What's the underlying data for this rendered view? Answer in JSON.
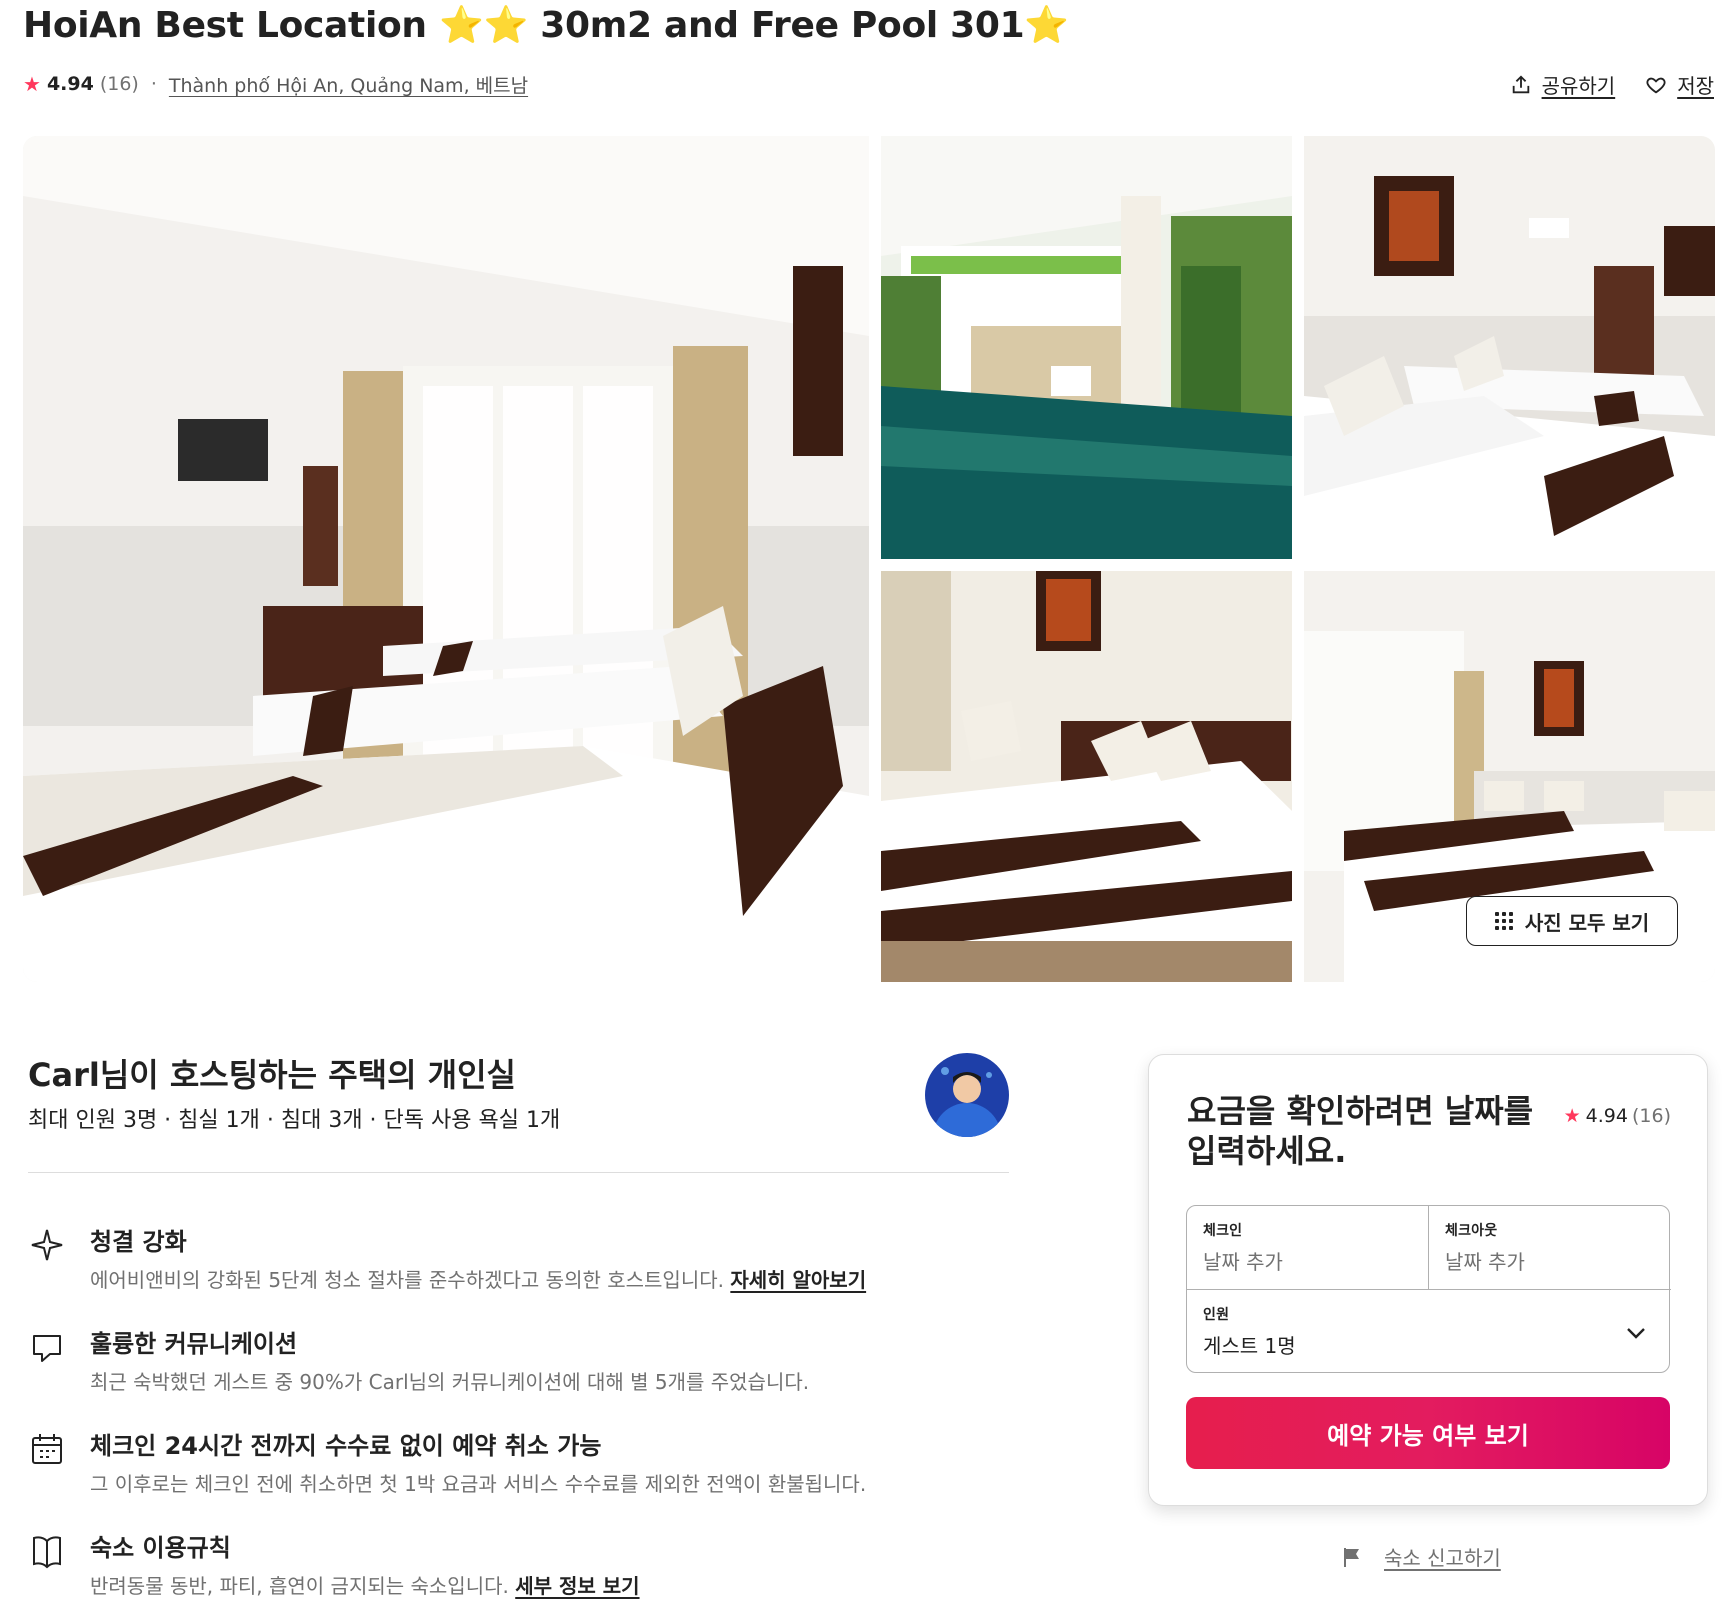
{
  "listing": {
    "title": "HoiAn Best Location",
    "title_part2": "30m2 and Free Pool 301",
    "rating": "4.94",
    "reviews": "(16)",
    "location": "Thành phố Hội An, Quảng Nam, 베트남",
    "share_label": "공유하기",
    "save_label": "저장"
  },
  "gallery": {
    "photos": [
      "bedroom-main",
      "pool",
      "bedroom-triple",
      "bedroom-double",
      "bedroom-wide"
    ],
    "show_all_label": "사진 모두 보기"
  },
  "host": {
    "title": "Carl님이 호스팅하는 주택의 개인실",
    "summary": "최대 인원 3명 · 침실 1개 · 침대 3개 · 단독 사용 욕실 1개"
  },
  "features": [
    {
      "icon": "sparkle-icon",
      "title": "청결 강화",
      "desc": "에어비앤비의 강화된 5단계 청소 절차를 준수하겠다고 동의한 호스트입니다.",
      "link": "자세히 알아보기"
    },
    {
      "icon": "chat-bubble-icon",
      "title": "훌륭한 커뮤니케이션",
      "desc": "최근 숙박했던 게스트 중 90%가 Carl님의 커뮤니케이션에 대해 별 5개를 주었습니다."
    },
    {
      "icon": "calendar-icon",
      "title": "체크인 24시간 전까지 수수료 없이 예약 취소 가능",
      "desc": "그 이후로는 체크인 전에 취소하면 첫 1박 요금과 서비스 수수료를 제외한 전액이 환불됩니다."
    },
    {
      "icon": "rulebook-icon",
      "title": "숙소 이용규칙",
      "desc": "반려동물 동반, 파티, 흡연이 금지되는 숙소입니다.",
      "link": "세부 정보 보기"
    }
  ],
  "booking": {
    "title": "요금을 확인하려면 날짜를 입력하세요.",
    "rating": "4.94",
    "reviews": "(16)",
    "checkin_label": "체크인",
    "checkin_value": "날짜 추가",
    "checkout_label": "체크아웃",
    "checkout_value": "날짜 추가",
    "guests_label": "인원",
    "guests_value": "게스트 1명",
    "button": "예약 가능 여부 보기"
  },
  "report_label": "숙소 신고하기",
  "colors": {
    "accent": "#ff385c",
    "button_start": "#e61e4d",
    "button_end": "#d70466",
    "star": "#f5c518"
  }
}
